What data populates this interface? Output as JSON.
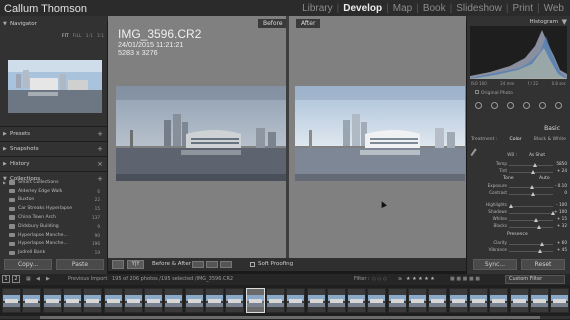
{
  "app": {
    "user": "Callum Thomson",
    "modules": [
      "Library",
      "Develop",
      "Map",
      "Book",
      "Slideshow",
      "Print",
      "Web"
    ],
    "active_module": "Develop"
  },
  "left_panel": {
    "navigator": {
      "title": "Navigator",
      "options": [
        "FIT",
        "FILL",
        "1:1",
        "3:1"
      ]
    },
    "presets": "Presets",
    "snapshots": "Snapshots",
    "history": "History",
    "collections": {
      "title": "Collections",
      "items": [
        {
          "name": "Smart Collections",
          "count": ""
        },
        {
          "name": "Alderley Edge Walk",
          "count": "6"
        },
        {
          "name": "Buxton",
          "count": "22"
        },
        {
          "name": "Car Streaks Hyperlapse",
          "count": "15"
        },
        {
          "name": "China Town Arch",
          "count": "137"
        },
        {
          "name": "Didsbury Building",
          "count": "9"
        },
        {
          "name": "Hyperlapse Manche...",
          "count": "90"
        },
        {
          "name": "Hyperlapse Manche...",
          "count": "196"
        },
        {
          "name": "Jodrell Bank",
          "count": "19"
        }
      ]
    },
    "buttons": {
      "copy": "Copy...",
      "paste": "Paste"
    }
  },
  "center": {
    "before_label": "Before",
    "after_label": "After",
    "filename": "IMG_3596.CR2",
    "datetime": "24/01/2015 11:21:21",
    "dimensions": "5283 x 3276"
  },
  "toolbar": {
    "view_mode": "Y|Y",
    "before_after": "Before & After :",
    "soft_proofing": "Soft Proofing"
  },
  "right_panel": {
    "histogram_title": "Histogram",
    "hist_info": [
      "ISO 100",
      "24 mm",
      "f / 22",
      "0.8 sec"
    ],
    "original_photo": "Original Photo",
    "basic_title": "Basic",
    "treatment": {
      "label": "Treatment :",
      "options": [
        "Color",
        "Black & White"
      ],
      "active": "Color"
    },
    "wb": {
      "label": "WB :",
      "value": "As Shot"
    },
    "temp": {
      "label": "Temp",
      "value": "5850"
    },
    "tint": {
      "label": "Tint",
      "value": "+ 24"
    },
    "tone": {
      "label": "Tone",
      "auto": "Auto"
    },
    "exposure": {
      "label": "Exposure",
      "value": "- 0.10"
    },
    "contrast": {
      "label": "Contrast",
      "value": "0"
    },
    "highlights": {
      "label": "Highlights",
      "value": "- 100"
    },
    "shadows": {
      "label": "Shadows",
      "value": "+ 100"
    },
    "whites": {
      "label": "Whites",
      "value": "+ 15"
    },
    "blacks": {
      "label": "Blacks",
      "value": "+ 32"
    },
    "presence": {
      "label": "Presence"
    },
    "clarity": {
      "label": "Clarity",
      "value": "+ 60"
    },
    "vibrance": {
      "label": "Vibrance",
      "value": "+ 45"
    },
    "buttons": {
      "sync": "Sync...",
      "reset": "Reset"
    }
  },
  "filmstrip": {
    "page1": "1",
    "page2": "2",
    "source": "Previous Import",
    "count": "195 of 206 photos /195 selected /IMG_3596.CR2",
    "filter_label": "Filter :",
    "filter_value": "Custom Filter"
  }
}
